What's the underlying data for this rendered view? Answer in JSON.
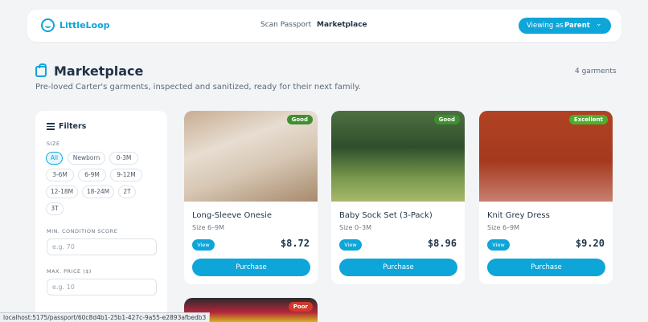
{
  "nav": {
    "brand": "LittleLoop",
    "links": [
      "Scan Passport",
      "Marketplace"
    ],
    "viewing_label": "Viewing as",
    "viewing_value": "Parent"
  },
  "header": {
    "title": "Marketplace",
    "subtitle": "Pre-loved Carter's garments, inspected and sanitized, ready for their next family.",
    "count": "4 garments"
  },
  "filters": {
    "title": "Filters",
    "size_label": "SIZE",
    "sizes": [
      "All",
      "Newborn",
      "0-3M",
      "3-6M",
      "6-9M",
      "9-12M",
      "12-18M",
      "18-24M",
      "2T",
      "3T"
    ],
    "selected_size": "All",
    "min_condition_label": "MIN. CONDITION SCORE",
    "min_condition_placeholder": "e.g. 70",
    "max_price_label": "MAX. PRICE ($)",
    "max_price_placeholder": "e.g. 10"
  },
  "products": [
    {
      "name": "Long-Sleeve Onesie",
      "size": "Size 6–9M",
      "price": "$8.72",
      "condition": "Good",
      "condition_color": "#3f8f2f",
      "view_label": "View",
      "buy_label": "Purchase"
    },
    {
      "name": "Baby Sock Set (3-Pack)",
      "size": "Size 0–3M",
      "price": "$8.96",
      "condition": "Good",
      "condition_color": "#3f8f2f",
      "view_label": "View",
      "buy_label": "Purchase"
    },
    {
      "name": "Knit Grey Dress",
      "size": "Size 6–9M",
      "price": "$9.20",
      "condition": "Excellent",
      "condition_color": "#4caf2e",
      "view_label": "View",
      "buy_label": "Purchase"
    },
    {
      "condition": "Poor",
      "condition_color": "#d13a2a"
    }
  ],
  "status_bar": "localhost:5175/passport/60c8d4b1-25b1-427c-9a55-e2893afbedb3"
}
